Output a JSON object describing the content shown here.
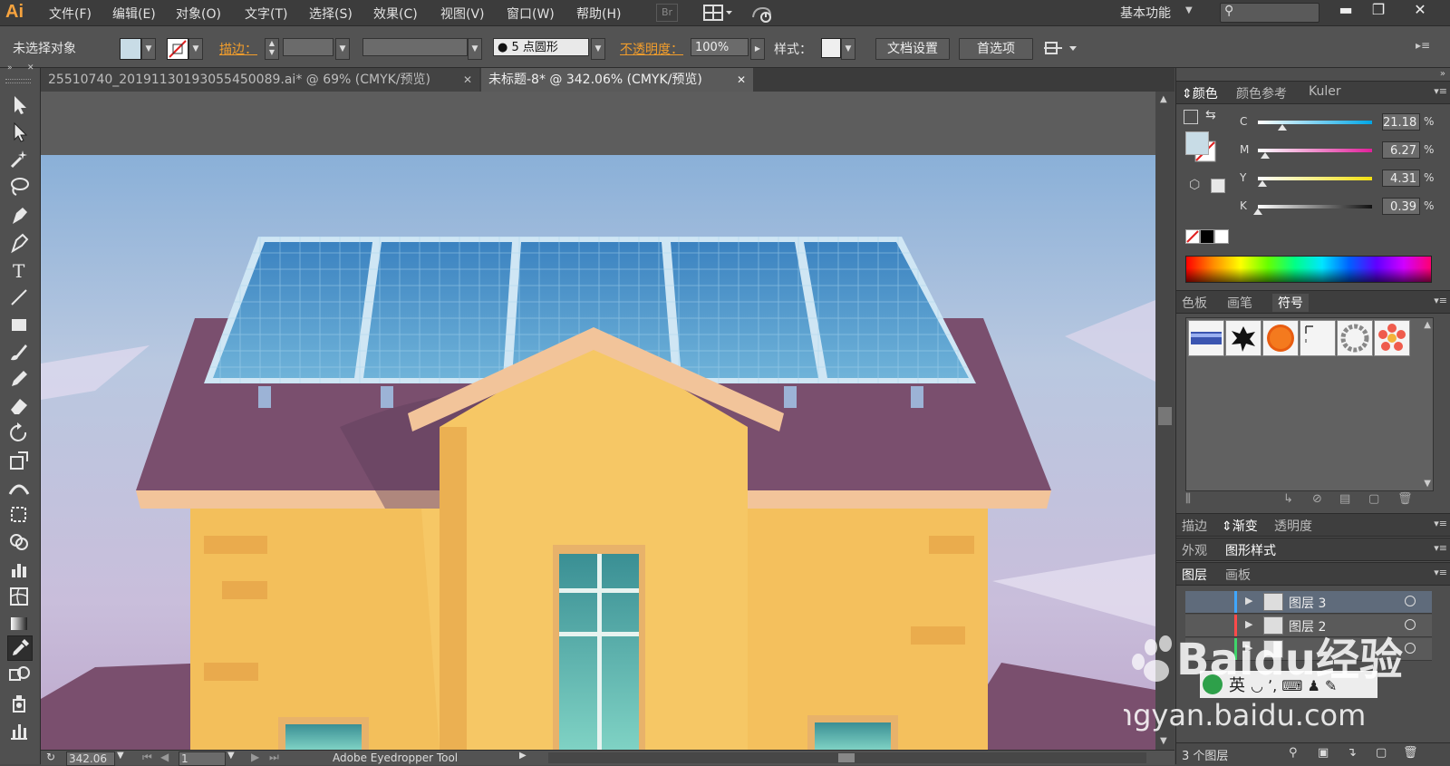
{
  "app": {
    "logo": "Ai"
  },
  "menu": [
    "文件(F)",
    "编辑(E)",
    "对象(O)",
    "文字(T)",
    "选择(S)",
    "效果(C)",
    "视图(V)",
    "窗口(W)",
    "帮助(H)"
  ],
  "bridge_label": "Br",
  "workspace_label": "基本功能",
  "control": {
    "selection_status": "未选择对象",
    "stroke_label": "描边：",
    "brush_label": "5 点圆形",
    "opacity_label": "不透明度：",
    "opacity_value": "100%",
    "style_label": "样式：",
    "doc_setup": "文档设置",
    "preferences": "首选项"
  },
  "tabs": [
    {
      "title": "25510740_20191130193055450089.ai* @ 69% (CMYK/预览)"
    },
    {
      "title": "未标题-8* @ 342.06% (CMYK/预览)"
    }
  ],
  "panels": {
    "color_tabs": [
      "颜色",
      "颜色参考",
      "Kuler"
    ],
    "cmyk": [
      {
        "label": "C",
        "value": "21.18",
        "fraction": 0.2118
      },
      {
        "label": "M",
        "value": "6.27",
        "fraction": 0.0627
      },
      {
        "label": "Y",
        "value": "4.31",
        "fraction": 0.0431
      },
      {
        "label": "K",
        "value": "0.39",
        "fraction": 0.0039
      }
    ],
    "percent_sign": "%",
    "swatch_tabs": [
      "色板",
      "画笔",
      "符号"
    ],
    "stroke_tabs": [
      "描边",
      "渐变",
      "透明度"
    ],
    "appearance_tabs": [
      "外观",
      "图形样式"
    ],
    "layer_tabs": [
      "图层",
      "画板"
    ],
    "layers": [
      {
        "name": "图层 3",
        "color": "#3fa7ff",
        "selected": true
      },
      {
        "name": "图层 2",
        "color": "#ff4a4a",
        "selected": false
      },
      {
        "name": "",
        "color": "#3fd46a",
        "selected": false
      }
    ],
    "layer_count": "3 个图层"
  },
  "status": {
    "zoom": "342.06",
    "page": "1",
    "tool": "Adobe Eyedropper Tool"
  },
  "watermark": {
    "text": "Baidu经验",
    "url": "jingyan.baidu.com",
    "ime_label": "英"
  },
  "colors": {
    "accent": "#f7a33e",
    "fill_swatch": "#c8dce6",
    "house_wall": "#f6c765",
    "roof": "#7a4f6e",
    "panel": "#4d8fbe"
  }
}
